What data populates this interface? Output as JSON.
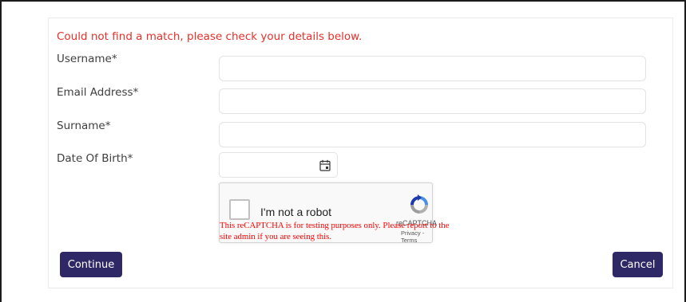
{
  "form": {
    "error_message": "Could not find a match, please check your details below.",
    "username_label": "Username*",
    "username_value": "",
    "email_label": "Email Address*",
    "email_value": "",
    "surname_label": "Surname*",
    "surname_value": "",
    "dob_label": "Date Of Birth*",
    "dob_icon": "calendar-icon"
  },
  "recaptcha": {
    "checkbox_label": "I'm not a robot",
    "brand": "reCAPTCHA",
    "links": "Privacy - Terms",
    "warning": "This reCAPTCHA is for testing purposes only. Please report to the site admin if you are seeing this.",
    "logo_icon": "recaptcha-logo-icon"
  },
  "actions": {
    "continue_label": "Continue",
    "cancel_label": "Cancel"
  },
  "colors": {
    "error": "#e5302b",
    "button_bg": "#2f2866",
    "warning": "#ff0000"
  }
}
